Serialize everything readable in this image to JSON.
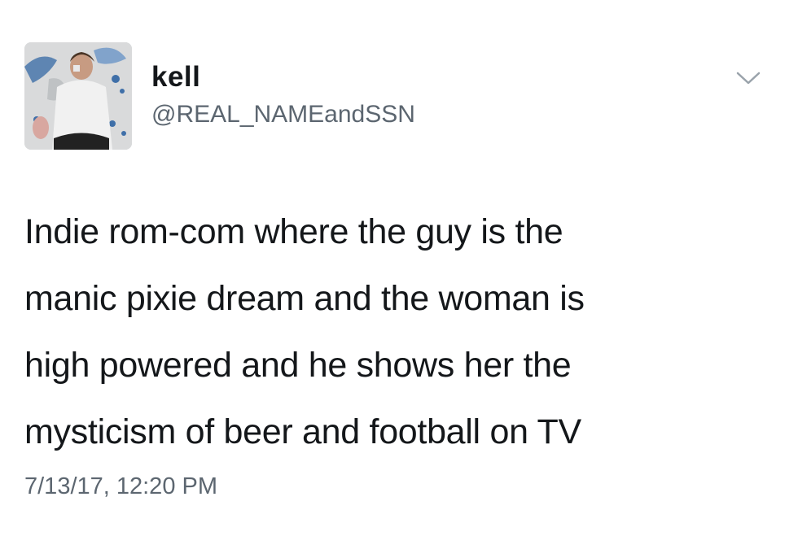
{
  "user": {
    "display_name": "kell",
    "handle": "@REAL_NAMEandSSN"
  },
  "tweet": {
    "lines": [
      "Indie rom-com where the guy is the",
      "manic pixie dream and the woman is",
      "high powered and he shows her the",
      "mysticism of beer and football on TV"
    ],
    "timestamp": "7/13/17, 12:20 PM"
  },
  "icons": {
    "menu": "chevron-down-icon"
  },
  "colors": {
    "text": "#14171a",
    "secondary_text": "#5c6670",
    "background": "#ffffff"
  }
}
